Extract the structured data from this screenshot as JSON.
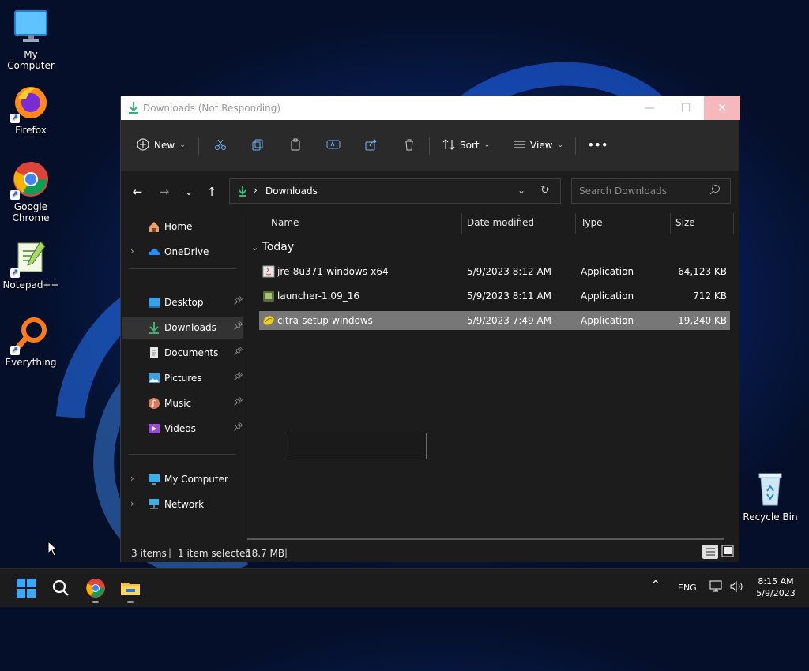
{
  "desktop": {
    "icons": [
      {
        "label": "My Computer"
      },
      {
        "label": "Firefox"
      },
      {
        "label": "Google Chrome"
      },
      {
        "label": "Notepad++"
      },
      {
        "label": "Everything"
      },
      {
        "label": "Recycle Bin"
      }
    ]
  },
  "window": {
    "title": "Downloads (Not Responding)",
    "toolbar": {
      "new_label": "New",
      "sort_label": "Sort",
      "view_label": "View",
      "more_label": "•••"
    },
    "address": {
      "breadcrumb_separator": "›",
      "current": "Downloads",
      "search_placeholder": "Search Downloads"
    },
    "nav": {
      "home": "Home",
      "onedrive": "OneDrive",
      "quick": [
        {
          "label": "Desktop"
        },
        {
          "label": "Downloads"
        },
        {
          "label": "Documents"
        },
        {
          "label": "Pictures"
        },
        {
          "label": "Music"
        },
        {
          "label": "Videos"
        }
      ],
      "my_computer": "My Computer",
      "network": "Network"
    },
    "columns": {
      "name": "Name",
      "date": "Date modified",
      "type": "Type",
      "size": "Size"
    },
    "group_label": "Today",
    "files": [
      {
        "name": "jre-8u371-windows-x64",
        "date": "5/9/2023 8:12 AM",
        "type": "Application",
        "size": "64,123 KB"
      },
      {
        "name": "launcher-1.09_16",
        "date": "5/9/2023 8:11 AM",
        "type": "Application",
        "size": "712 KB"
      },
      {
        "name": "citra-setup-windows",
        "date": "5/9/2023 7:49 AM",
        "type": "Application",
        "size": "19,240 KB"
      }
    ],
    "status": {
      "items": "3 items",
      "selected": "1 item selected",
      "size": "18.7 MB",
      "sep": "|"
    }
  },
  "taskbar": {
    "language": "ENG",
    "time": "8:15 AM",
    "date": "5/9/2023"
  },
  "colors": {
    "accent": "#0078d4",
    "download_green": "#3cb371",
    "close_button": "#f4b8bd",
    "selected_row": "#777777"
  }
}
